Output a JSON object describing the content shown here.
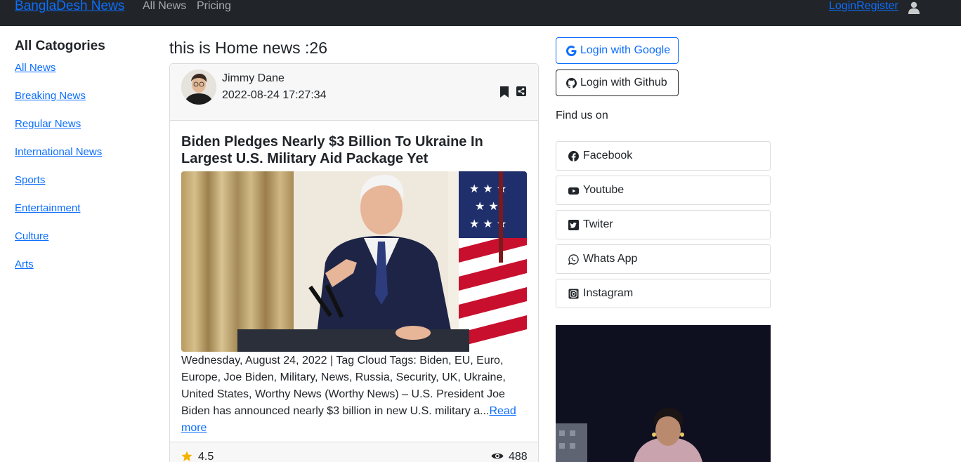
{
  "navbar": {
    "brand": "BanglaDesh News",
    "links": [
      "All News",
      "Pricing"
    ],
    "auth": "LoginRegister"
  },
  "sidebar": {
    "title": "All Catogories",
    "categories": [
      "All News",
      "Breaking News",
      "Regular News",
      "International News",
      "Sports",
      "Entertainment",
      "Culture",
      "Arts"
    ]
  },
  "main": {
    "title": "this is Home news :26",
    "card": {
      "author": "Jimmy Dane",
      "date": "2022-08-24 17:27:34",
      "headline": "Biden Pledges Nearly $3 Billion To Ukraine In Largest U.S. Military Aid Package Yet",
      "excerpt": "Wednesday, August 24, 2022 | Tag Cloud Tags: Biden, EU, Euro, Europe, Joe Biden, Military, News, Russia, Security, UK, Ukraine, United States, Worthy News (Worthy News) – U.S. President Joe Biden has announced nearly $3 billion in new U.S. military a...",
      "read_more": "Read more",
      "rating": "4.5",
      "views": "488"
    }
  },
  "right": {
    "google_login": "Login with Google",
    "github_login": "Login with Github",
    "find_us": "Find us on",
    "socials": [
      "Facebook",
      "Youtube",
      "Twiter",
      "Whats App",
      "Instagram"
    ]
  },
  "colors": {
    "navbar": "#212529",
    "link": "#0d6efd",
    "star": "#f5b301"
  }
}
